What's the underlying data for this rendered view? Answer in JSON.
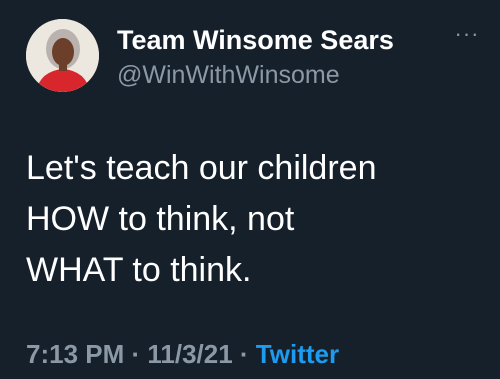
{
  "tweet": {
    "display_name": "Team Winsome Sears",
    "handle": "@WinWithWinsome",
    "more_icon": "more-dots-icon",
    "text_lines": [
      "Let's teach our children",
      "HOW to think, not",
      "WHAT to think."
    ],
    "time": "7:13 PM",
    "separator": " · ",
    "date": "11/3/21",
    "source": "Twitter"
  },
  "colors": {
    "background": "#15202b",
    "primary_text": "#ffffff",
    "secondary_text": "#8b98a5",
    "link": "#1d9bf0"
  }
}
